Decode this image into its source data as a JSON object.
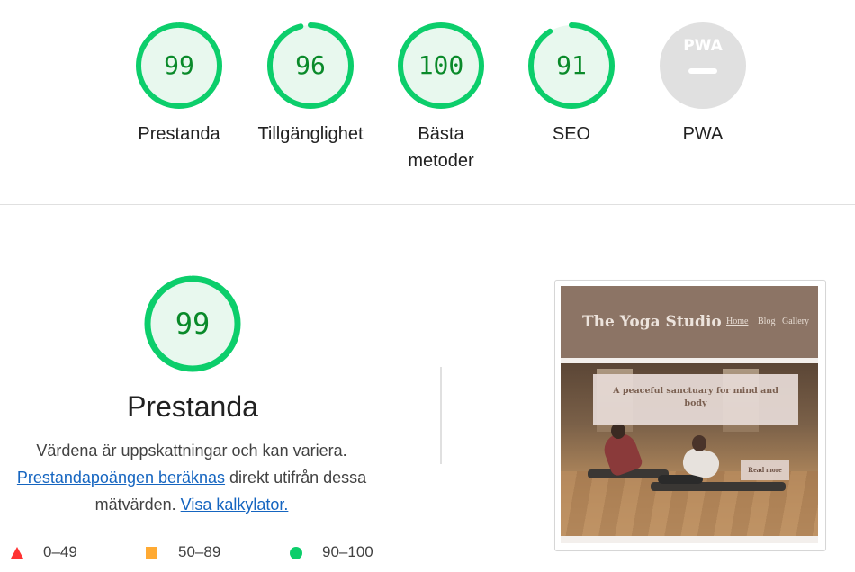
{
  "summary": {
    "categories": [
      {
        "label": "Prestanda",
        "score": "99",
        "value": 99
      },
      {
        "label": "Tillgänglighet",
        "score": "96",
        "value": 96
      },
      {
        "label_lines": [
          "Bästa",
          "metoder"
        ],
        "score": "100",
        "value": 100
      },
      {
        "label": "SEO",
        "score": "91",
        "value": 91
      },
      {
        "label": "PWA",
        "badge_text": "PWA"
      }
    ]
  },
  "performance": {
    "score": "99",
    "value": 99,
    "title": "Prestanda",
    "desc_line1": "Värdena är uppskattningar och kan variera.",
    "link_calc": "Prestandapoängen beräknas",
    "desc_mid": " direkt utifrån dessa mätvärden. ",
    "link_calculator": "Visa kalkylator."
  },
  "legend": [
    {
      "icon": "fail-triangle-icon",
      "range": "0–49",
      "color": "#ff3333"
    },
    {
      "icon": "average-square-icon",
      "range": "50–89",
      "color": "#ffaa33"
    },
    {
      "icon": "pass-circle-icon",
      "range": "90–100",
      "color": "#0cce6b"
    }
  ],
  "screenshot": {
    "brand": "The Yoga Studio",
    "nav": [
      "Home",
      "Blog",
      "Gallery"
    ],
    "caption": "A peaceful sanctuary for mind and body",
    "button": "Read more"
  },
  "colors": {
    "pass": "#0cce6b",
    "pass_fill": "#e8f8ee",
    "pass_text": "#0a8a2a",
    "link": "#1565c0",
    "pwa_grey": "#e0e0e0"
  }
}
